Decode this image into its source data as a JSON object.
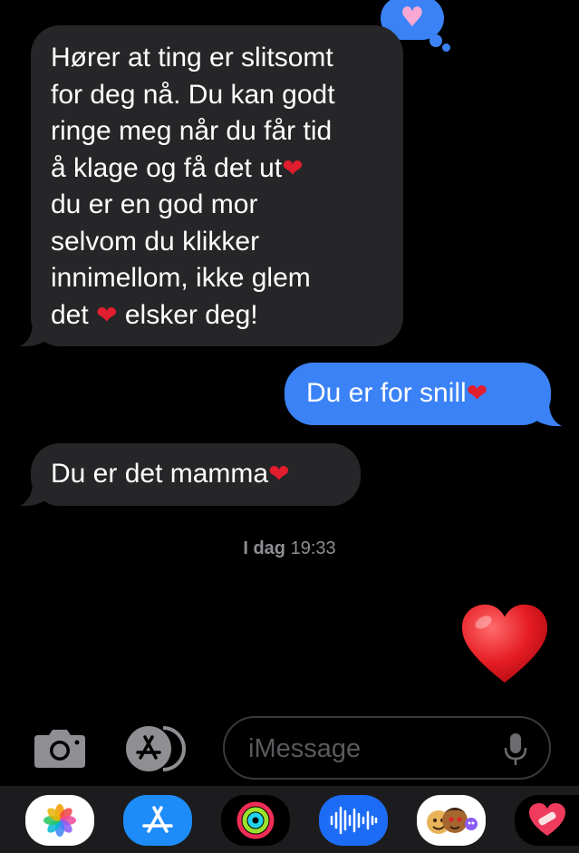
{
  "conversation": {
    "messages": [
      {
        "direction": "incoming",
        "lines": [
          "Hører at ting er slitsomt",
          "for deg nå. Du kan godt",
          "ringe meg når du får tid",
          "å klage og få det ut",
          "du er en god mor",
          "selvom du klikker",
          "innimellom, ikke glem",
          "det ",
          " elsker deg!"
        ],
        "reaction": "heart"
      },
      {
        "direction": "outgoing",
        "text": "Du er for snill"
      },
      {
        "direction": "incoming",
        "text": "Du er det mamma"
      }
    ],
    "timestamp": {
      "day": "I dag",
      "time": "19:33"
    },
    "last_message_emoji": "red-heart"
  },
  "composer": {
    "placeholder": "iMessage",
    "camera_icon": "camera-icon",
    "apps_icon": "app-store-icon",
    "mic_icon": "microphone-icon"
  },
  "app_drawer": {
    "apps": [
      {
        "name": "photos-app-icon"
      },
      {
        "name": "app-store-app-icon"
      },
      {
        "name": "activity-app-icon"
      },
      {
        "name": "audio-message-app-icon"
      },
      {
        "name": "memoji-app-icon"
      },
      {
        "name": "heart-sticker-app-icon"
      }
    ]
  },
  "colors": {
    "incoming_bubble": "#262628",
    "outgoing_bubble": "#3b82f6",
    "background": "#000000",
    "heart": "#e11d2e"
  }
}
